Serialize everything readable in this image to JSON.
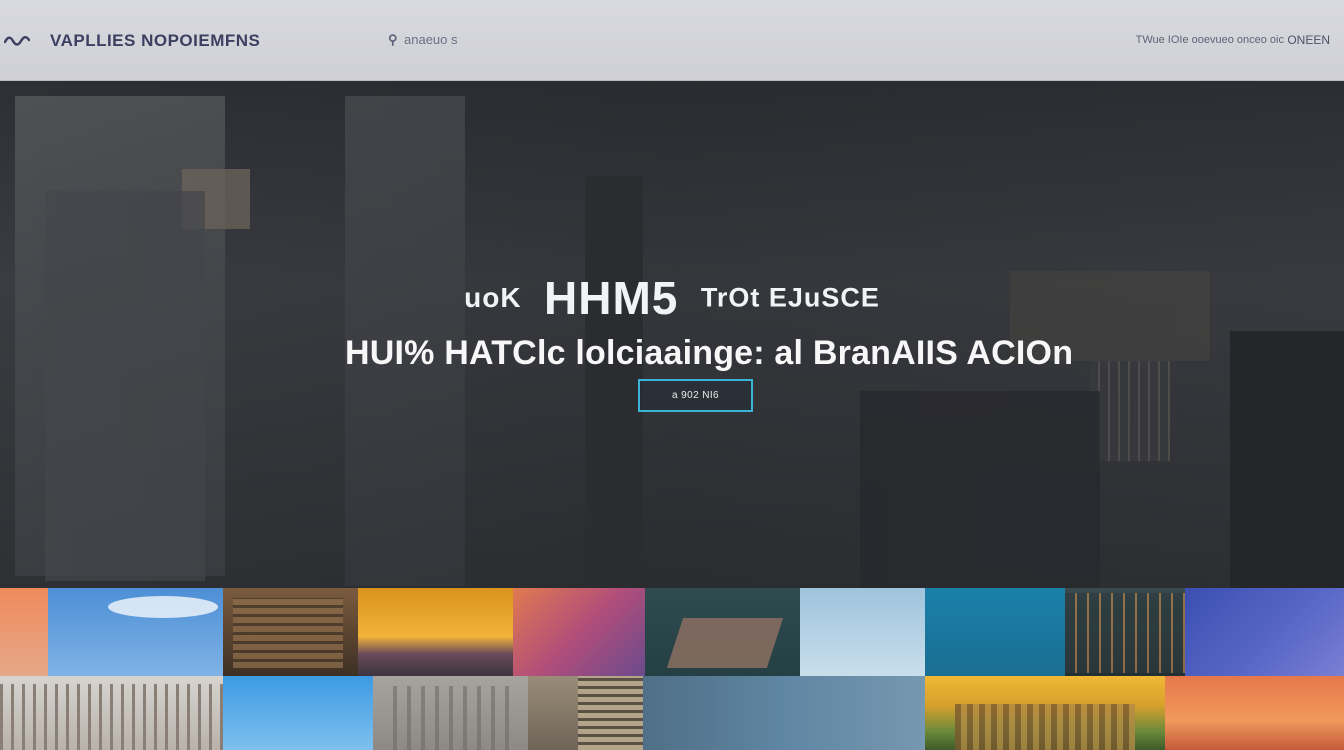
{
  "nav": {
    "brand": "VAPLLIES  NOPOIEMFNS",
    "search_label": "anaeuo s",
    "links": "TWue  IOIe  ooevueo  onceo oic",
    "menu_label": "ONEEN"
  },
  "hero": {
    "kicker_pre": "uoK",
    "kicker_big": "HHM5",
    "kicker_post": "TrOt EJuSCE",
    "headline": "HUI% HATClc lolciaainge: al BranAIIS ACIOn",
    "cta_label": "a 902 NI6"
  },
  "colors": {
    "nav_bg": "#d5d6dc",
    "brand_text": "#3c4060",
    "cta_border": "#3bb3d6"
  },
  "thumbnails": [
    {
      "name": "sunset-sky"
    },
    {
      "name": "blue-sky-clouds"
    },
    {
      "name": "city-tower"
    },
    {
      "name": "orange-horizon"
    },
    {
      "name": "purple-gradient"
    },
    {
      "name": "dark-teal-book"
    },
    {
      "name": "pale-sky"
    },
    {
      "name": "teal-blue"
    },
    {
      "name": "building-lights"
    },
    {
      "name": "indigo-gradient"
    },
    {
      "name": "scaffold-structure"
    },
    {
      "name": "sky-blue"
    },
    {
      "name": "misty-buildings"
    },
    {
      "name": "tower-facade"
    },
    {
      "name": "blue-haze"
    },
    {
      "name": "golden-castle"
    },
    {
      "name": "orange-glow"
    }
  ]
}
